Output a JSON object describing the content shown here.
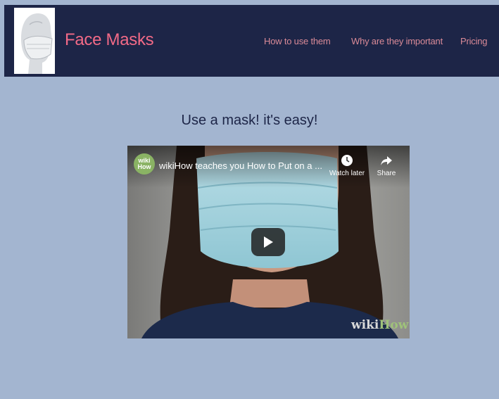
{
  "header": {
    "brand": "Face Masks",
    "nav": [
      "How to use them",
      "Why are they important",
      "Pricing"
    ]
  },
  "main": {
    "headline": "Use a mask! it's easy!"
  },
  "video": {
    "channel_badge_top": "wiki",
    "channel_badge_bottom": "How",
    "title": "wikiHow teaches you How to Put on a ...",
    "watch_later_label": "Watch later",
    "share_label": "Share",
    "watermark_wiki": "wiki",
    "watermark_how": "How"
  },
  "icons": {
    "logo": "mannequin-mask-icon",
    "play": "play-icon",
    "watch_later": "clock-icon",
    "share": "share-arrow-icon"
  },
  "colors": {
    "page_bg": "#a3b5d0",
    "header_bg": "#1d2547",
    "brand": "#f26a87",
    "nav": "#d98a97",
    "headline": "#1d2547"
  }
}
